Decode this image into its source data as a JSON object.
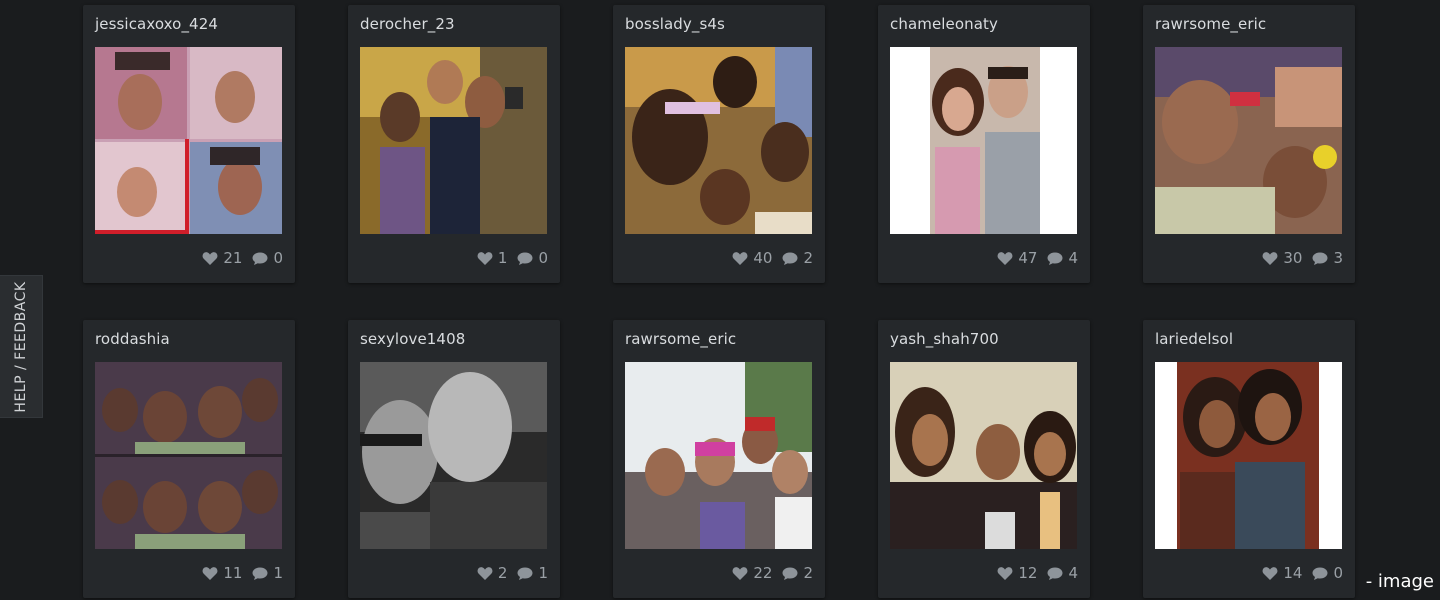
{
  "feedback_tab": {
    "label": "HELP / FEEDBACK"
  },
  "posts": [
    {
      "username": "jessicaxoxo_424",
      "likes": "21",
      "comments": "0"
    },
    {
      "username": "derocher_23",
      "likes": "1",
      "comments": "0"
    },
    {
      "username": "bosslady_s4s",
      "likes": "40",
      "comments": "2"
    },
    {
      "username": "chameleonaty",
      "likes": "47",
      "comments": "4"
    },
    {
      "username": "rawrsome_eric",
      "likes": "30",
      "comments": "3"
    },
    {
      "username": "roddashia",
      "likes": "11",
      "comments": "1"
    },
    {
      "username": "sexylove1408",
      "likes": "2",
      "comments": "1"
    },
    {
      "username": "rawrsome_eric",
      "likes": "22",
      "comments": "2"
    },
    {
      "username": "yash_shah700",
      "likes": "12",
      "comments": "4"
    },
    {
      "username": "lariedelsol",
      "likes": "14",
      "comments": "0"
    }
  ],
  "icons": {
    "likes": "heart-icon",
    "comments": "speech-bubble-icon"
  },
  "colors": {
    "background": "#1a1c1e",
    "card": "#25282b",
    "text": "#d9dcdf",
    "meta": "#9aa0a6"
  },
  "caption": "- image"
}
